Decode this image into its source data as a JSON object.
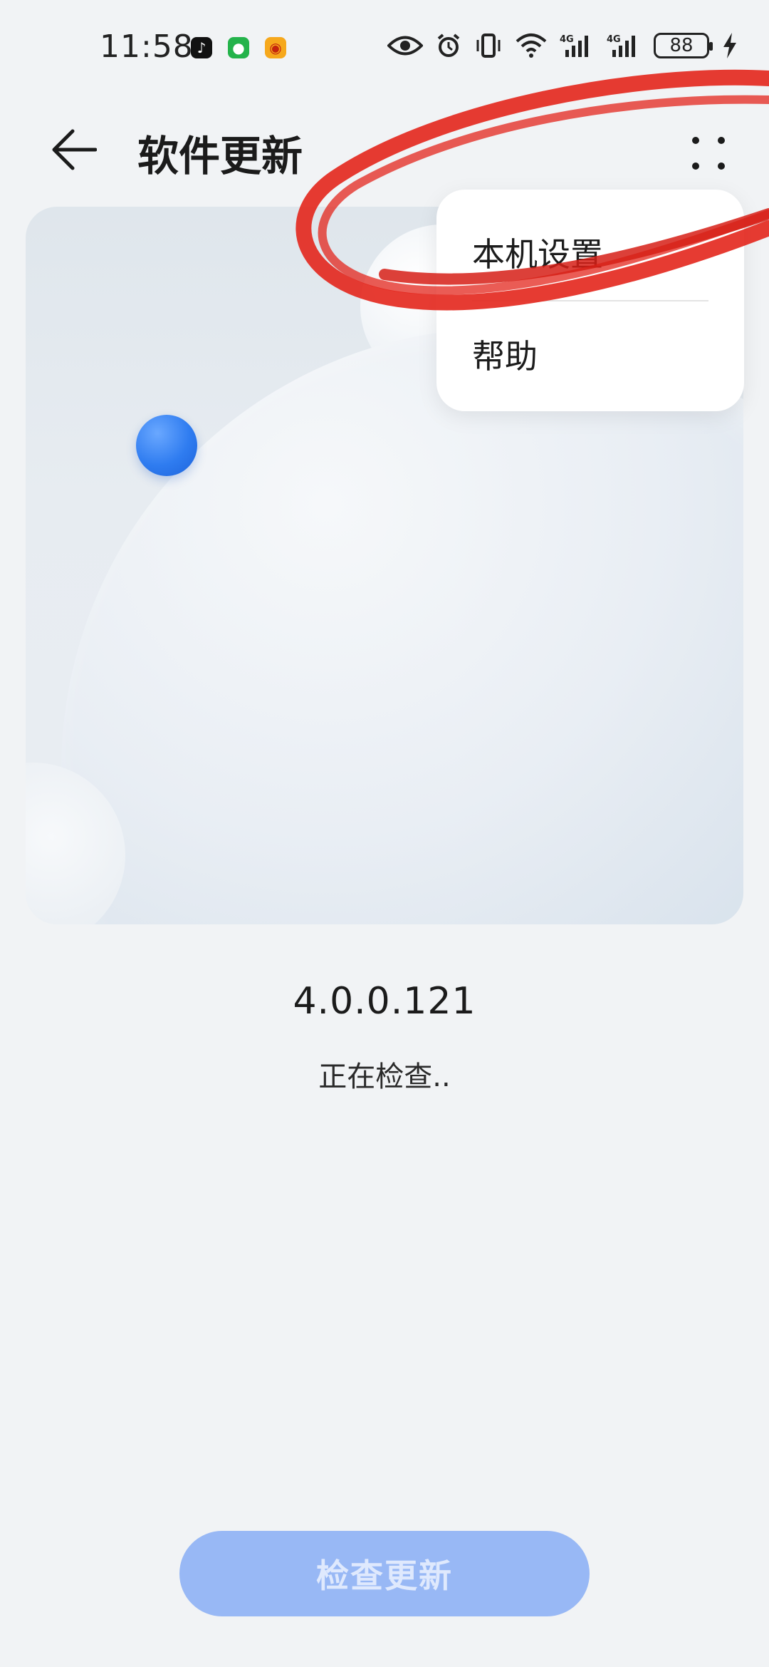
{
  "status_bar": {
    "time": "11:58",
    "battery": "88",
    "icons": [
      "tiktok-icon",
      "wechat-icon",
      "weibo-icon",
      "eye-icon",
      "alarm-icon",
      "vibrate-icon",
      "wifi-icon",
      "signal-4g-icon",
      "signal-4g-icon",
      "battery-icon",
      "charging-icon"
    ]
  },
  "header": {
    "title": "软件更新",
    "back_icon": "back-arrow-icon",
    "more_icon": "more-dots-icon"
  },
  "popup_menu": {
    "items": [
      {
        "label": "本机设置"
      },
      {
        "label": "帮助"
      }
    ]
  },
  "main": {
    "version": "4.0.0.121",
    "status_text": "正在检查.."
  },
  "bottom": {
    "check_button_label": "检查更新"
  },
  "colors": {
    "background": "#f1f3f5",
    "accent_button": "#98b8f5",
    "blue_ball": "#2f7cf0",
    "scribble": "#e3261c"
  }
}
